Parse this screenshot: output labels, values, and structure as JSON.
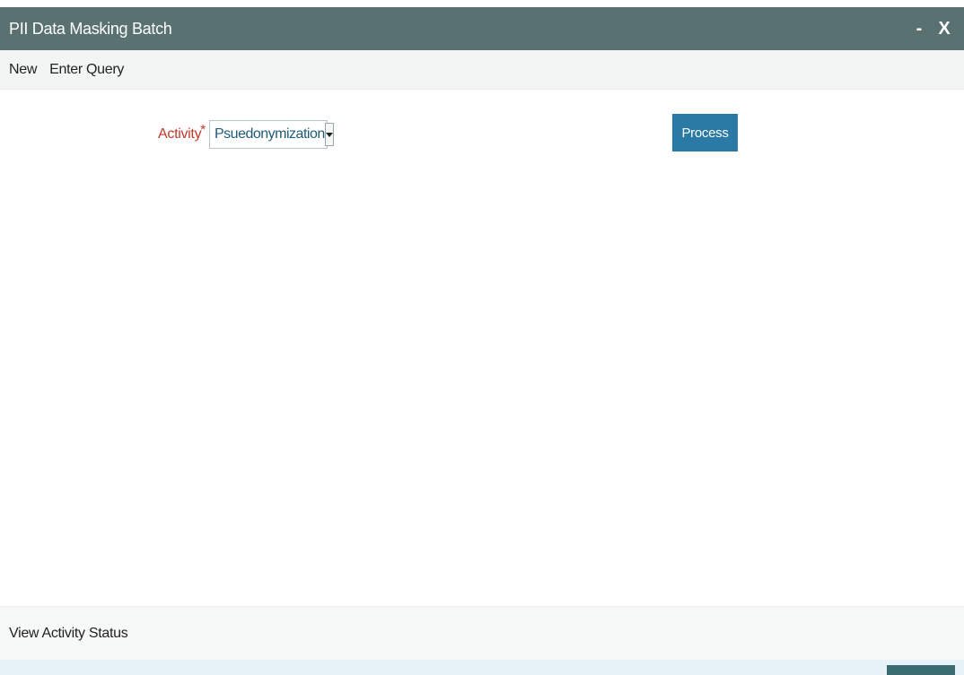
{
  "window": {
    "title": "PII Data Masking Batch",
    "minimize_label": "-",
    "close_label": "X"
  },
  "menu": {
    "items": [
      "New",
      "Enter Query"
    ]
  },
  "form": {
    "activity_label": "Activity",
    "required_marker": "*",
    "activity_value": "Psuedonymization",
    "process_label": "Process"
  },
  "status": {
    "view_activity_status_label": "View Activity Status"
  },
  "colors": {
    "titlebar": "#5a7172",
    "accent_button": "#2b7aa5",
    "required_label": "#c0392b",
    "select_text": "#1e5b78"
  }
}
